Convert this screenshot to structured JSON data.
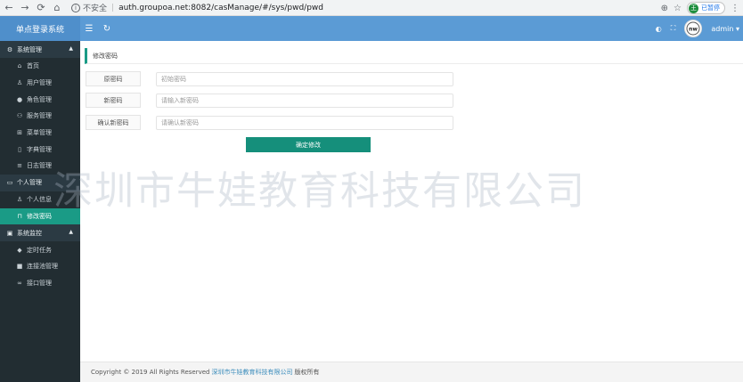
{
  "browser": {
    "insecure_label": "不安全",
    "url": "auth.groupoa.net:8082/casManage/#/sys/pwd/pwd",
    "paused_label": "已暂停",
    "profile_initial": "王"
  },
  "header": {
    "brand": "单点登录系统",
    "user": "admin"
  },
  "sidebar": {
    "groups": [
      {
        "label": "系统管理",
        "items": [
          "首页",
          "用户管理",
          "角色管理",
          "服务管理",
          "菜单管理",
          "字典管理",
          "日志管理"
        ]
      },
      {
        "label": "个人管理",
        "items": [
          "个人信息",
          "修改密码"
        ]
      },
      {
        "label": "系统监控",
        "items": [
          "定时任务",
          "连接池管理",
          "接口管理"
        ]
      }
    ]
  },
  "page": {
    "tab_title": "修改密码",
    "form": {
      "old_label": "原密码",
      "old_placeholder": "初始密码",
      "new_label": "新密码",
      "new_placeholder": "请输入新密码",
      "confirm_label": "确认新密码",
      "confirm_placeholder": "请确认新密码",
      "submit_label": "确定修改"
    },
    "watermark": "深圳市牛娃教育科技有限公司"
  },
  "footer": {
    "prefix": "Copyright © 2019 All Rights Reserved",
    "company": "深圳市牛娃教育科技有限公司",
    "suffix": "版权所有"
  },
  "colors": {
    "header": "#5b9bd5",
    "sidebar": "#222d32",
    "active": "#1a9b86",
    "button": "#158f7b"
  }
}
